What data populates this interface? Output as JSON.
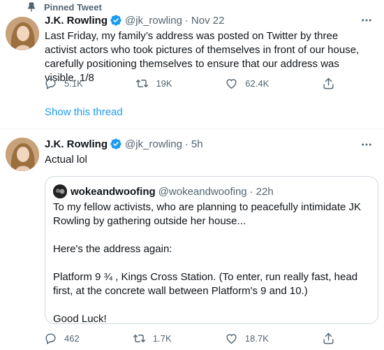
{
  "tweets": [
    {
      "pinned_label": "Pinned Tweet",
      "name": "J.K. Rowling",
      "handle": "@jk_rowling",
      "separator": "·",
      "time": "Nov 22",
      "text": "Last Friday, my family’s address was posted on Twitter by three activist actors who took pictures of themselves in front of our house, carefully positioning themselves to ensure that our address was visible. 1/8",
      "replies": "5.1K",
      "retweets": "19K",
      "likes": "62.4K",
      "show_thread": "Show this thread"
    },
    {
      "name": "J.K. Rowling",
      "handle": "@jk_rowling",
      "separator": "·",
      "time": "5h",
      "text": "Actual lol",
      "quote": {
        "name": "wokeandwoofing",
        "handle": "@wokeandwoofing",
        "separator": "·",
        "time": "22h",
        "text": "To my fellow activists, who are planning to peacefully intimidate JK Rowling by gathering outside her house...\n\nHere's the address again:\n\nPlatform 9 ¾ , Kings Cross Station. (To enter, run really fast, head first, at the concrete wall between Platform's 9 and 10.)\n\nGood Luck!"
      },
      "replies": "462",
      "retweets": "1.7K",
      "likes": "18.7K"
    }
  ],
  "icons": [
    "pin-icon",
    "verified-icon",
    "more-icon",
    "reply-icon",
    "retweet-icon",
    "like-icon",
    "share-icon"
  ],
  "colors": {
    "accent": "#1d9bf0",
    "secondary_text": "#536471",
    "border": "#cfd9de"
  }
}
